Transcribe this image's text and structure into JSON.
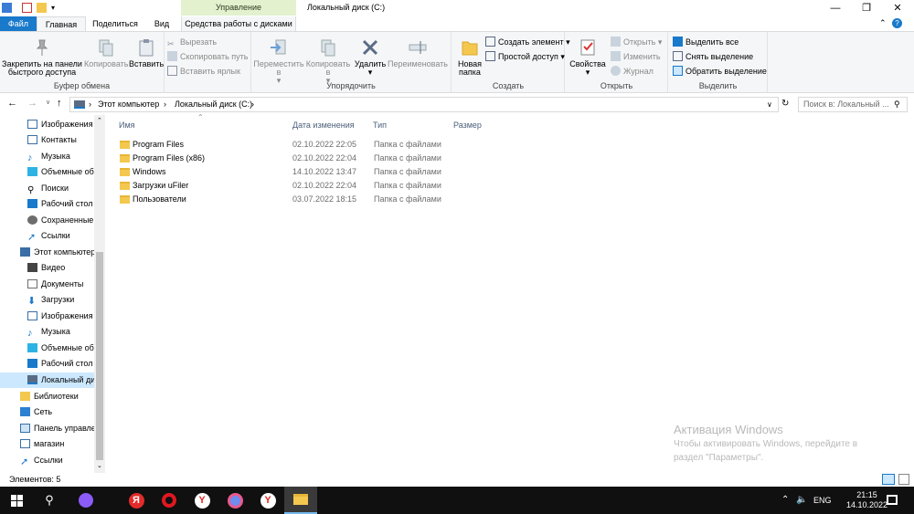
{
  "window": {
    "context_header": "Управление",
    "title": "Локальный диск (C:)"
  },
  "tabs": {
    "file": "Файл",
    "home": "Главная",
    "share": "Поделиться",
    "view": "Вид",
    "drive_tools": "Средства работы с дисками"
  },
  "ribbon": {
    "clipboard": {
      "label": "Буфер обмена",
      "pin": "Закрепить на панели быстрого доступа",
      "copy": "Копировать",
      "paste": "Вставить",
      "cut": "Вырезать",
      "copy_path": "Скопировать путь",
      "paste_shortcut": "Вставить ярлык"
    },
    "organize": {
      "label": "Упорядочить",
      "move_to": "Переместить в",
      "copy_to": "Копировать в",
      "delete": "Удалить",
      "rename": "Переименовать"
    },
    "new": {
      "label": "Создать",
      "new_folder": "Новая папка",
      "new_item": "Создать элемент",
      "easy_access": "Простой доступ"
    },
    "open": {
      "label": "Открыть",
      "properties": "Свойства",
      "open": "Открыть",
      "edit": "Изменить",
      "history": "Журнал"
    },
    "select": {
      "label": "Выделить",
      "select_all": "Выделить все",
      "select_none": "Снять выделение",
      "invert": "Обратить выделение"
    }
  },
  "address": {
    "crumbs": [
      "Этот компьютер",
      "Локальный диск (C:)"
    ],
    "search_placeholder": "Поиск в: Локальный ..."
  },
  "nav": [
    {
      "label": "Изображения",
      "icon": "pictures-icon"
    },
    {
      "label": "Контакты",
      "icon": "contacts-icon"
    },
    {
      "label": "Музыка",
      "icon": "music-icon"
    },
    {
      "label": "Объемные об",
      "icon": "3d-objects-icon"
    },
    {
      "label": "Поиски",
      "icon": "search-icon"
    },
    {
      "label": "Рабочий стол",
      "icon": "desktop-icon"
    },
    {
      "label": "Сохраненные",
      "icon": "saved-games-icon"
    },
    {
      "label": "Ссылки",
      "icon": "links-icon"
    },
    {
      "label": "Этот компьютер",
      "icon": "computer-icon"
    },
    {
      "label": "Видео",
      "icon": "video-icon"
    },
    {
      "label": "Документы",
      "icon": "documents-icon"
    },
    {
      "label": "Загрузки",
      "icon": "downloads-icon"
    },
    {
      "label": "Изображения",
      "icon": "pictures-icon"
    },
    {
      "label": "Музыка",
      "icon": "music-icon"
    },
    {
      "label": "Объемные об",
      "icon": "3d-objects-icon"
    },
    {
      "label": "Рабочий стол",
      "icon": "desktop-icon"
    },
    {
      "label": "Локальный ди",
      "icon": "drive-icon"
    },
    {
      "label": "Библиотеки",
      "icon": "libraries-icon"
    },
    {
      "label": "Сеть",
      "icon": "network-icon"
    },
    {
      "label": "Панель управле",
      "icon": "control-panel-icon"
    },
    {
      "label": "магазин",
      "icon": "store-icon"
    },
    {
      "label": "Ссылки",
      "icon": "links-icon"
    }
  ],
  "columns": {
    "name": "Имя",
    "date": "Дата изменения",
    "type": "Тип",
    "size": "Размер"
  },
  "files": [
    {
      "name": "Program Files",
      "date": "02.10.2022 22:05",
      "type": "Папка с файлами"
    },
    {
      "name": "Program Files (x86)",
      "date": "02.10.2022 22:04",
      "type": "Папка с файлами"
    },
    {
      "name": "Windows",
      "date": "14.10.2022 13:47",
      "type": "Папка с файлами"
    },
    {
      "name": "Загрузки uFiler",
      "date": "02.10.2022 22:04",
      "type": "Папка с файлами"
    },
    {
      "name": "Пользователи",
      "date": "03.07.2022 18:15",
      "type": "Папка с файлами"
    }
  ],
  "status": {
    "items": "Элементов: 5"
  },
  "watermark": {
    "line1": "Активация Windows",
    "line2": "Чтобы активировать Windows, перейдите в",
    "line3": "раздел \"Параметры\"."
  },
  "taskbar": {
    "lang": "ENG",
    "time": "21:15",
    "date": "14.10.2022"
  },
  "colors": {
    "accent": "#1979ca",
    "context_tab": "#e3f1cf",
    "folder": "#f4c84f",
    "selected_nav": "#cce8ff"
  }
}
